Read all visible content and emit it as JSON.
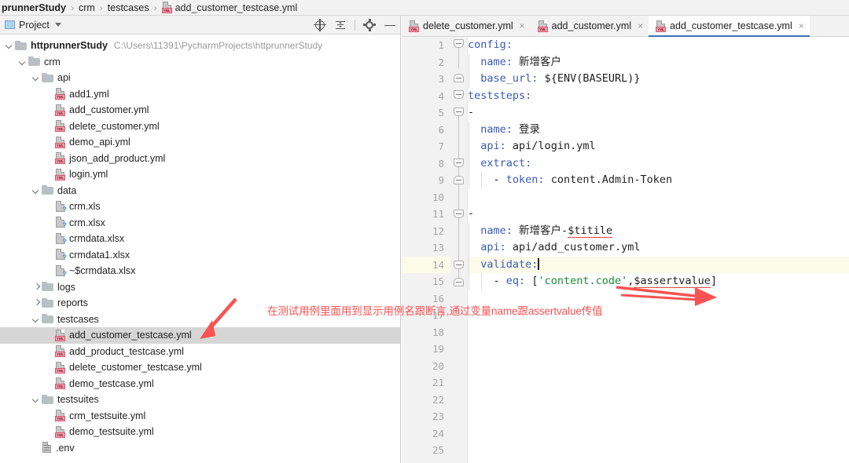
{
  "breadcrumb": {
    "items": [
      {
        "label": "prunnerStudy",
        "bold": true,
        "icon": null
      },
      {
        "label": "crm",
        "bold": false,
        "icon": null
      },
      {
        "label": "testcases",
        "bold": false,
        "icon": null
      },
      {
        "label": "add_customer_testcase.yml",
        "bold": false,
        "icon": "yml-icon"
      }
    ],
    "separator": "›"
  },
  "project_panel": {
    "title": "Project",
    "dropdown_caret": "▾",
    "toolbar_buttons": [
      {
        "name": "locate-in-tree",
        "icon": "target-icon"
      },
      {
        "name": "collapse-all",
        "icon": "collapse-all-icon"
      },
      {
        "name": "settings",
        "icon": "gear-icon"
      },
      {
        "name": "hide",
        "icon": "minimize-icon"
      }
    ],
    "root": {
      "label": "httprunnerStudy",
      "path": "C:\\Users\\11391\\PycharmProjects\\httprunnerStudy"
    },
    "tree": [
      {
        "label": "httprunnerStudy",
        "path": "C:\\Users\\11391\\PycharmProjects\\httprunnerStudy",
        "depth": 0,
        "type": "folder",
        "state": "open",
        "bold": true,
        "selected": false
      },
      {
        "label": "crm",
        "depth": 1,
        "type": "folder",
        "state": "open",
        "selected": false
      },
      {
        "label": "api",
        "depth": 2,
        "type": "folder",
        "state": "open",
        "selected": false
      },
      {
        "label": "add1.yml",
        "depth": 3,
        "type": "yml",
        "selected": false
      },
      {
        "label": "add_customer.yml",
        "depth": 3,
        "type": "yml",
        "selected": false
      },
      {
        "label": "delete_customer.yml",
        "depth": 3,
        "type": "yml",
        "selected": false
      },
      {
        "label": "demo_api.yml",
        "depth": 3,
        "type": "yml",
        "selected": false
      },
      {
        "label": "json_add_product.yml",
        "depth": 3,
        "type": "yml",
        "selected": false
      },
      {
        "label": "login.yml",
        "depth": 3,
        "type": "yml",
        "selected": false
      },
      {
        "label": "data",
        "depth": 2,
        "type": "folder",
        "state": "open",
        "selected": false
      },
      {
        "label": "crm.xls",
        "depth": 3,
        "type": "unknown",
        "selected": false
      },
      {
        "label": "crm.xlsx",
        "depth": 3,
        "type": "unknown",
        "selected": false
      },
      {
        "label": "crmdata.xlsx",
        "depth": 3,
        "type": "unknown",
        "selected": false
      },
      {
        "label": "crmdata1.xlsx",
        "depth": 3,
        "type": "unknown",
        "selected": false
      },
      {
        "label": "~$crmdata.xlsx",
        "depth": 3,
        "type": "unknown",
        "selected": false
      },
      {
        "label": "logs",
        "depth": 2,
        "type": "folder",
        "state": "closed",
        "selected": false
      },
      {
        "label": "reports",
        "depth": 2,
        "type": "folder",
        "state": "closed",
        "selected": false
      },
      {
        "label": "testcases",
        "depth": 2,
        "type": "folder",
        "state": "open",
        "selected": false
      },
      {
        "label": "add_customer_testcase.yml",
        "depth": 3,
        "type": "yml",
        "selected": true
      },
      {
        "label": "add_product_testcase.yml",
        "depth": 3,
        "type": "yml",
        "selected": false
      },
      {
        "label": "delete_customer_testcase.yml",
        "depth": 3,
        "type": "yml",
        "selected": false
      },
      {
        "label": "demo_testcase.yml",
        "depth": 3,
        "type": "yml",
        "selected": false
      },
      {
        "label": "testsuites",
        "depth": 2,
        "type": "folder",
        "state": "open",
        "selected": false
      },
      {
        "label": "crm_testsuite.yml",
        "depth": 3,
        "type": "yml",
        "selected": false
      },
      {
        "label": "demo_testsuite.yml",
        "depth": 3,
        "type": "yml",
        "selected": false
      },
      {
        "label": ".env",
        "depth": 2,
        "type": "text",
        "selected": false
      }
    ]
  },
  "editor": {
    "tabs": [
      {
        "label": "delete_customer.yml",
        "active": false,
        "close": "×",
        "icon": "yml-icon"
      },
      {
        "label": "add_customer.yml",
        "active": false,
        "close": "×",
        "icon": "yml-icon"
      },
      {
        "label": "add_customer_testcase.yml",
        "active": true,
        "close": "×",
        "icon": "yml-icon"
      }
    ],
    "current_line": 14,
    "line_numbers": [
      1,
      2,
      3,
      4,
      5,
      6,
      7,
      8,
      9,
      10,
      11,
      12,
      13,
      14,
      15,
      16,
      17,
      18,
      19,
      20,
      21,
      22,
      23,
      24,
      25
    ],
    "lines": [
      {
        "n": 1,
        "text": "config:",
        "indent": 0
      },
      {
        "n": 2,
        "text": "  name: 新增客户",
        "indent": 1
      },
      {
        "n": 3,
        "text": "  base_url: ${ENV(BASEURL)}",
        "indent": 1
      },
      {
        "n": 4,
        "text": "teststeps:",
        "indent": 0
      },
      {
        "n": 5,
        "text": "-",
        "indent": 0
      },
      {
        "n": 6,
        "text": "  name: 登录",
        "indent": 1
      },
      {
        "n": 7,
        "text": "  api: api/login.yml",
        "indent": 1
      },
      {
        "n": 8,
        "text": "  extract:",
        "indent": 1
      },
      {
        "n": 9,
        "text": "    - token: content.Admin-Token",
        "indent": 2
      },
      {
        "n": 10,
        "text": "",
        "indent": 0
      },
      {
        "n": 11,
        "text": "-",
        "indent": 0
      },
      {
        "n": 12,
        "text": "  name: 新增客户-$titile",
        "indent": 1
      },
      {
        "n": 13,
        "text": "  api: api/add_customer.yml",
        "indent": 1
      },
      {
        "n": 14,
        "text": "  validate:",
        "indent": 1
      },
      {
        "n": 15,
        "text": "    - eq: ['content.code',$assertvalue]",
        "indent": 2
      },
      {
        "n": 16,
        "text": "",
        "indent": 0
      },
      {
        "n": 17,
        "text": "",
        "indent": 0
      },
      {
        "n": 18,
        "text": "",
        "indent": 0
      },
      {
        "n": 19,
        "text": "",
        "indent": 0
      },
      {
        "n": 20,
        "text": "",
        "indent": 0
      },
      {
        "n": 21,
        "text": "",
        "indent": 0
      },
      {
        "n": 22,
        "text": "",
        "indent": 0
      },
      {
        "n": 23,
        "text": "",
        "indent": 0
      },
      {
        "n": 24,
        "text": "",
        "indent": 0
      },
      {
        "n": 25,
        "text": "",
        "indent": 0
      }
    ],
    "code_tokens": {
      "l1_key": "config:",
      "l2_key": "name:",
      "l2_val": "新增客户",
      "l3_key": "base_url:",
      "l3_val": "${ENV(BASEURL)}",
      "l4_key": "teststeps:",
      "l5_dash": "-",
      "l6_key": "name:",
      "l6_val": "登录",
      "l7_key": "api:",
      "l7_val": "api/login.yml",
      "l8_key": "extract:",
      "l9_dash": "- ",
      "l9_key": "token:",
      "l9_val": "content.Admin-Token",
      "l11_dash": "-",
      "l12_key": "name:",
      "l12_val_plain": "新增客户-",
      "l12_val_var": "$titile",
      "l13_key": "api:",
      "l13_val": "api/add_customer.yml",
      "l14_key": "validate:",
      "l15_dash": "- ",
      "l15_key": "eq:",
      "l15_open": "[",
      "l15_str": "'content.code'",
      "l15_comma": ",",
      "l15_var": "$assertvalue",
      "l15_close": "]"
    }
  },
  "annotations": {
    "note": "在测试用例里面用到显示用例名跟断言,通过变量name跟assertvalue传值",
    "color": "#fa5252"
  },
  "colors": {
    "accent_tab_underline": "#3b74b5",
    "yaml_key": "#3b5bb5",
    "yaml_string": "#1a8a36",
    "selection_gray": "#d6d6d6",
    "current_line": "#fcfbe9",
    "annotation_red": "#fa5252",
    "gutter_bg": "#f2f2f2",
    "panel_bg": "#f2f2f2"
  }
}
